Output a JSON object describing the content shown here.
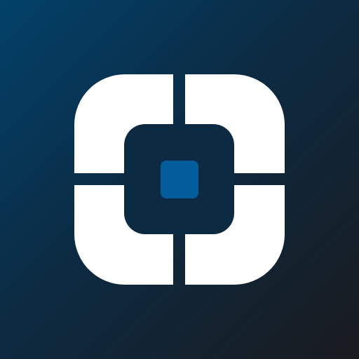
{
  "app_icon": {
    "icon": "target-frame-icon",
    "colors": {
      "background_start": "#02416a",
      "background_mid": "#0c2b43",
      "background_end": "#1a1b1f",
      "frame": "#ffffff",
      "inner_square": "#0c2b42",
      "center_dot": "#035d9b"
    }
  }
}
